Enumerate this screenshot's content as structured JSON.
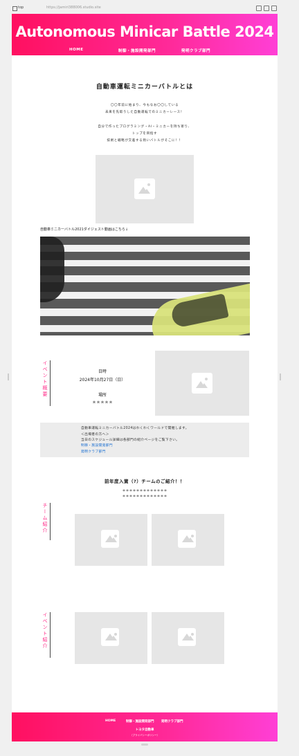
{
  "browser": {
    "tab_title": "top",
    "url": "https://jamiri388006.studio.site"
  },
  "header": {
    "title": "Autonomous Minicar Battle 2024",
    "nav": [
      "HOME",
      "制御・施設開発部門",
      "発明クラブ部門"
    ]
  },
  "intro": {
    "heading": "自動車運転ミニカーバトルとは",
    "lines": [
      "〇〇年前に始まり、今もなお〇〇している",
      "未来を先取りした自動運転でのミニカーレース！",
      "自分で作ったプログラミング・AI・ミニカーを持ち寄り、",
      "トップを目指す",
      "技術と戦略が交差する熱いバトルがそこに！！"
    ],
    "video_caption": "自動車ミニカーバトル2021ダイジェスト動画はこちら↓"
  },
  "event": {
    "section_label": "イベント概要",
    "date_label": "日時",
    "date_value": "2024年10月27日（日）",
    "place_label": "場所",
    "place_value": "＊＊＊＊＊",
    "notice": [
      "自動車運転ミニカーバトル2024はわくわくワールドで開催します。",
      "＜出場者の方へ＞",
      "当日のスケジュール詳細は各部門の紹介ページをご覧下さい。"
    ],
    "links": [
      "制御・施設開発部門",
      "発明クラブ部門"
    ]
  },
  "teams": {
    "heading": "前年度入賞（?）チームのご紹介！！",
    "line1": "＊＊＊＊＊＊＊＊＊＊＊＊＊",
    "line2": "＊＊＊＊＊＊＊＊＊＊＊＊＊",
    "section_label": "チーム紹介"
  },
  "events_intro": {
    "section_label": "イベント紹介"
  },
  "footer": {
    "nav": [
      "HOME",
      "制御・施設開発部門",
      "発明クラブ部門"
    ],
    "org": "トヨタ自動車",
    "privacy": "（プライバシーポリシー）"
  },
  "colors": {
    "accent": "#ff1a78",
    "gradient_start": "#ff1060",
    "gradient_end": "#ff3fd6",
    "link": "#1b6fd1"
  }
}
